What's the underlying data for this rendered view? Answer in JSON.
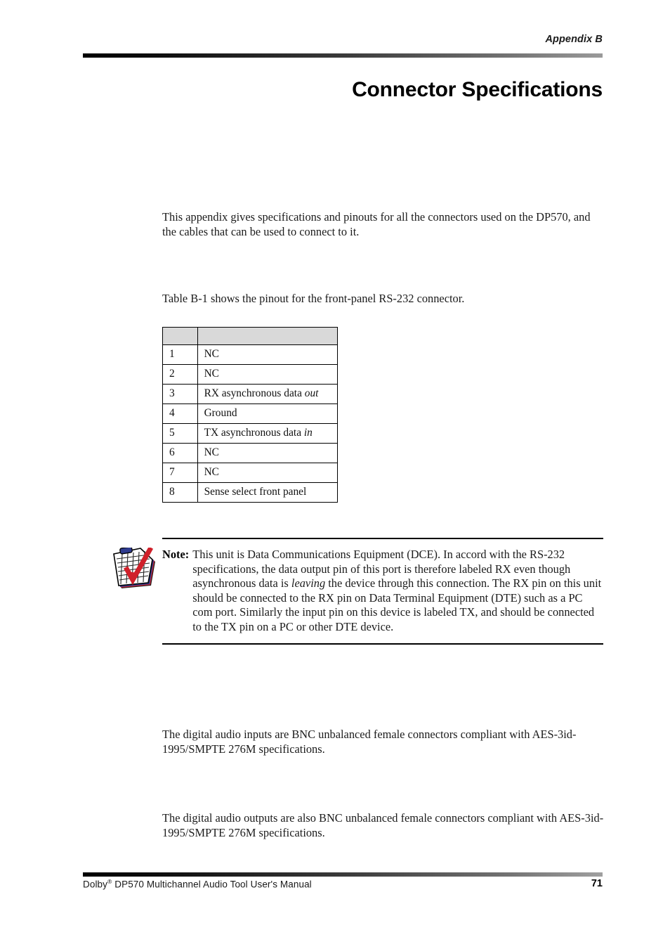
{
  "header": {
    "running_head": "Appendix B",
    "chapter_title": "Connector Specifications"
  },
  "main": {
    "intro_paragraph": "This appendix gives specifications and pinouts for all the connectors used on the DP570, and the cables that can be used to connect to it.",
    "table_reference_paragraph": "Table B-1 shows the pinout for the front-panel RS-232 connector.",
    "digital_inputs_paragraph": "The digital audio inputs are BNC unbalanced female connectors compliant with AES-3id-1995/SMPTE 276M specifications.",
    "digital_outputs_paragraph": "The digital audio outputs are also BNC unbalanced female connectors compliant with AES-3id-1995/SMPTE 276M specifications."
  },
  "pinout_table": {
    "headers": [
      "",
      ""
    ],
    "rows": [
      {
        "pin": "1",
        "description": "NC",
        "description_prefix": "NC",
        "description_italic": "",
        "description_suffix": ""
      },
      {
        "pin": "2",
        "description": "NC",
        "description_prefix": "NC",
        "description_italic": "",
        "description_suffix": ""
      },
      {
        "pin": "3",
        "description": "RX asynchronous data out",
        "description_prefix": "RX asynchronous data ",
        "description_italic": "out",
        "description_suffix": ""
      },
      {
        "pin": "4",
        "description": "Ground",
        "description_prefix": "Ground",
        "description_italic": "",
        "description_suffix": ""
      },
      {
        "pin": "5",
        "description": "TX asynchronous data in",
        "description_prefix": "TX asynchronous data ",
        "description_italic": "in",
        "description_suffix": ""
      },
      {
        "pin": "6",
        "description": "NC",
        "description_prefix": "NC",
        "description_italic": "",
        "description_suffix": ""
      },
      {
        "pin": "7",
        "description": "NC",
        "description_prefix": "NC",
        "description_italic": "",
        "description_suffix": ""
      },
      {
        "pin": "8",
        "description": "Sense select front panel",
        "description_prefix": "Sense select front panel",
        "description_italic": "",
        "description_suffix": ""
      }
    ]
  },
  "note": {
    "label": "Note:",
    "text_part1": "This unit is Data Communications Equipment (DCE). In accord with the RS-232 specifications, the data output pin of this port is therefore labeled RX even though asynchronous data is ",
    "text_italic": "leaving",
    "text_part2": " the device through this connection. The RX pin on this unit should be connected to the RX pin on Data Terminal Equipment (DTE) such as a PC com port. Similarly the input pin on this device is labeled TX, and should be connected to the TX pin on a PC or other DTE device.",
    "icon": "clipboard-check-icon"
  },
  "footer": {
    "manual_title_prefix": "Dolby",
    "manual_title_mark": "®",
    "manual_title_suffix": " DP570 Multichannel Audio Tool User's Manual",
    "page_number": "71"
  },
  "colors": {
    "table_header_fill": "#d9d9d9",
    "rule_dark": "#000000",
    "rule_light": "#a0a0a0",
    "icon_accent_red": "#d0202a",
    "icon_accent_blue": "#2f3c8f"
  }
}
